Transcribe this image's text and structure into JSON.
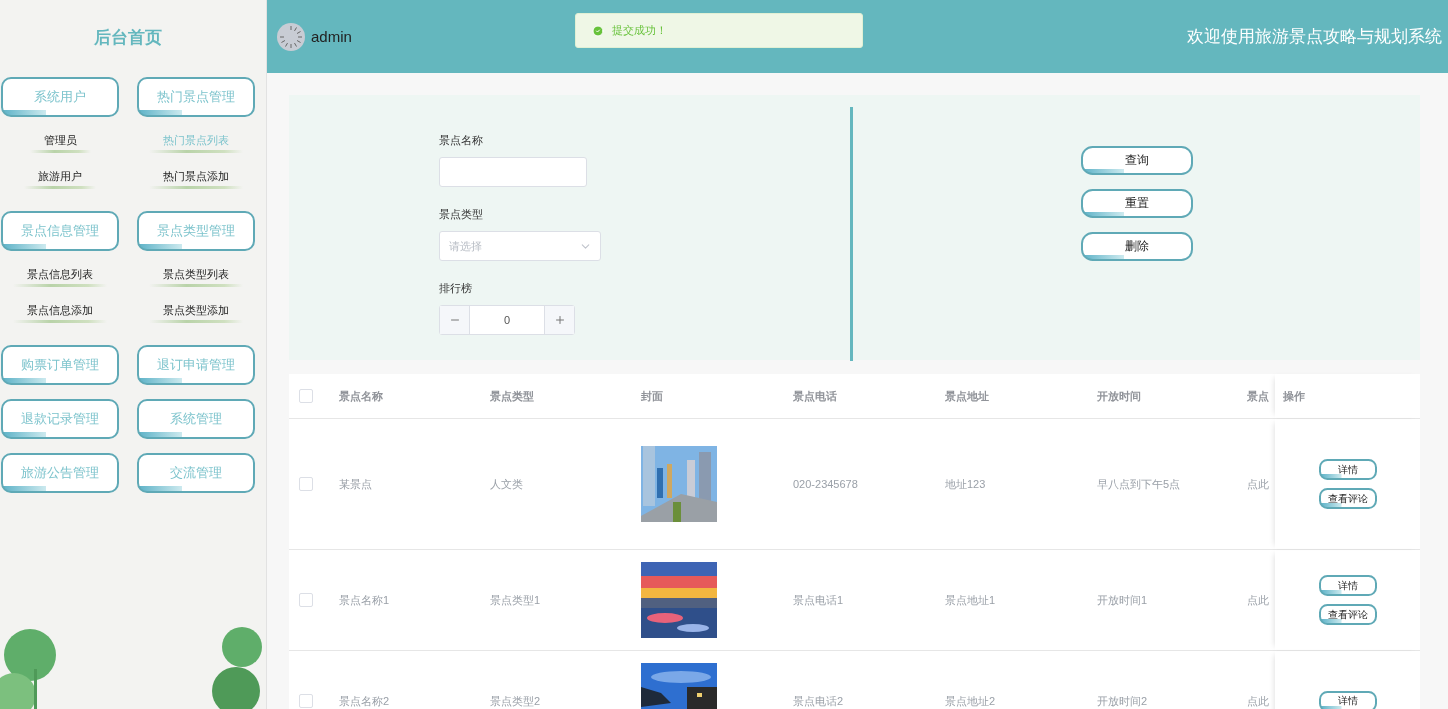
{
  "sidebar": {
    "title": "后台首页",
    "menu": [
      {
        "label": "系统用户",
        "children": [
          {
            "label": "管理员",
            "selected": false
          },
          {
            "label": "旅游用户",
            "selected": false
          }
        ]
      },
      {
        "label": "热门景点管理",
        "children": [
          {
            "label": "热门景点列表",
            "selected": true
          },
          {
            "label": "热门景点添加",
            "selected": false
          }
        ]
      },
      {
        "label": "景点信息管理",
        "children": [
          {
            "label": "景点信息列表",
            "selected": false
          },
          {
            "label": "景点信息添加",
            "selected": false
          }
        ]
      },
      {
        "label": "景点类型管理",
        "children": [
          {
            "label": "景点类型列表",
            "selected": false
          },
          {
            "label": "景点类型添加",
            "selected": false
          }
        ]
      },
      {
        "label": "购票订单管理"
      },
      {
        "label": "退订申请管理"
      },
      {
        "label": "退款记录管理"
      },
      {
        "label": "系统管理"
      },
      {
        "label": "旅游公告管理"
      },
      {
        "label": "交流管理"
      }
    ]
  },
  "header": {
    "user": "admin",
    "title": "欢迎使用旅游景点攻略与规划系统"
  },
  "toast": {
    "message": "提交成功！"
  },
  "search_form": {
    "fields": [
      {
        "kind": "text",
        "label": "景点名称"
      },
      {
        "kind": "select",
        "label": "景点类型",
        "placeholder": "请选择"
      },
      {
        "kind": "stepper",
        "label": "排行榜",
        "value": "0"
      }
    ],
    "buttons": [
      "查询",
      "重置",
      "删除"
    ]
  },
  "table": {
    "header_checked": false,
    "columns": [
      "景点名称",
      "景点类型",
      "封面",
      "景点电话",
      "景点地址",
      "开放时间",
      "景点",
      "操作"
    ],
    "rows": [
      {
        "checked": false,
        "cells": [
          "某景点",
          "人文类",
          {
            "kind": "picture"
          },
          "020-2345678",
          "地址123",
          "早八点到下午5点",
          "点此"
        ],
        "actions": [
          "详情",
          "查看评论"
        ]
      },
      {
        "checked": false,
        "cells": [
          "景点名称1",
          "景点类型1",
          {
            "kind": "picture"
          },
          "景点电话1",
          "景点地址1",
          "开放时间1",
          "点此"
        ],
        "actions": [
          "详情",
          "查看评论"
        ]
      },
      {
        "checked": false,
        "cells": [
          "景点名称2",
          "景点类型2",
          {
            "kind": "picture"
          },
          "景点电话2",
          "景点地址2",
          "开放时间2",
          "点此"
        ],
        "actions": [
          "详情"
        ]
      }
    ]
  }
}
